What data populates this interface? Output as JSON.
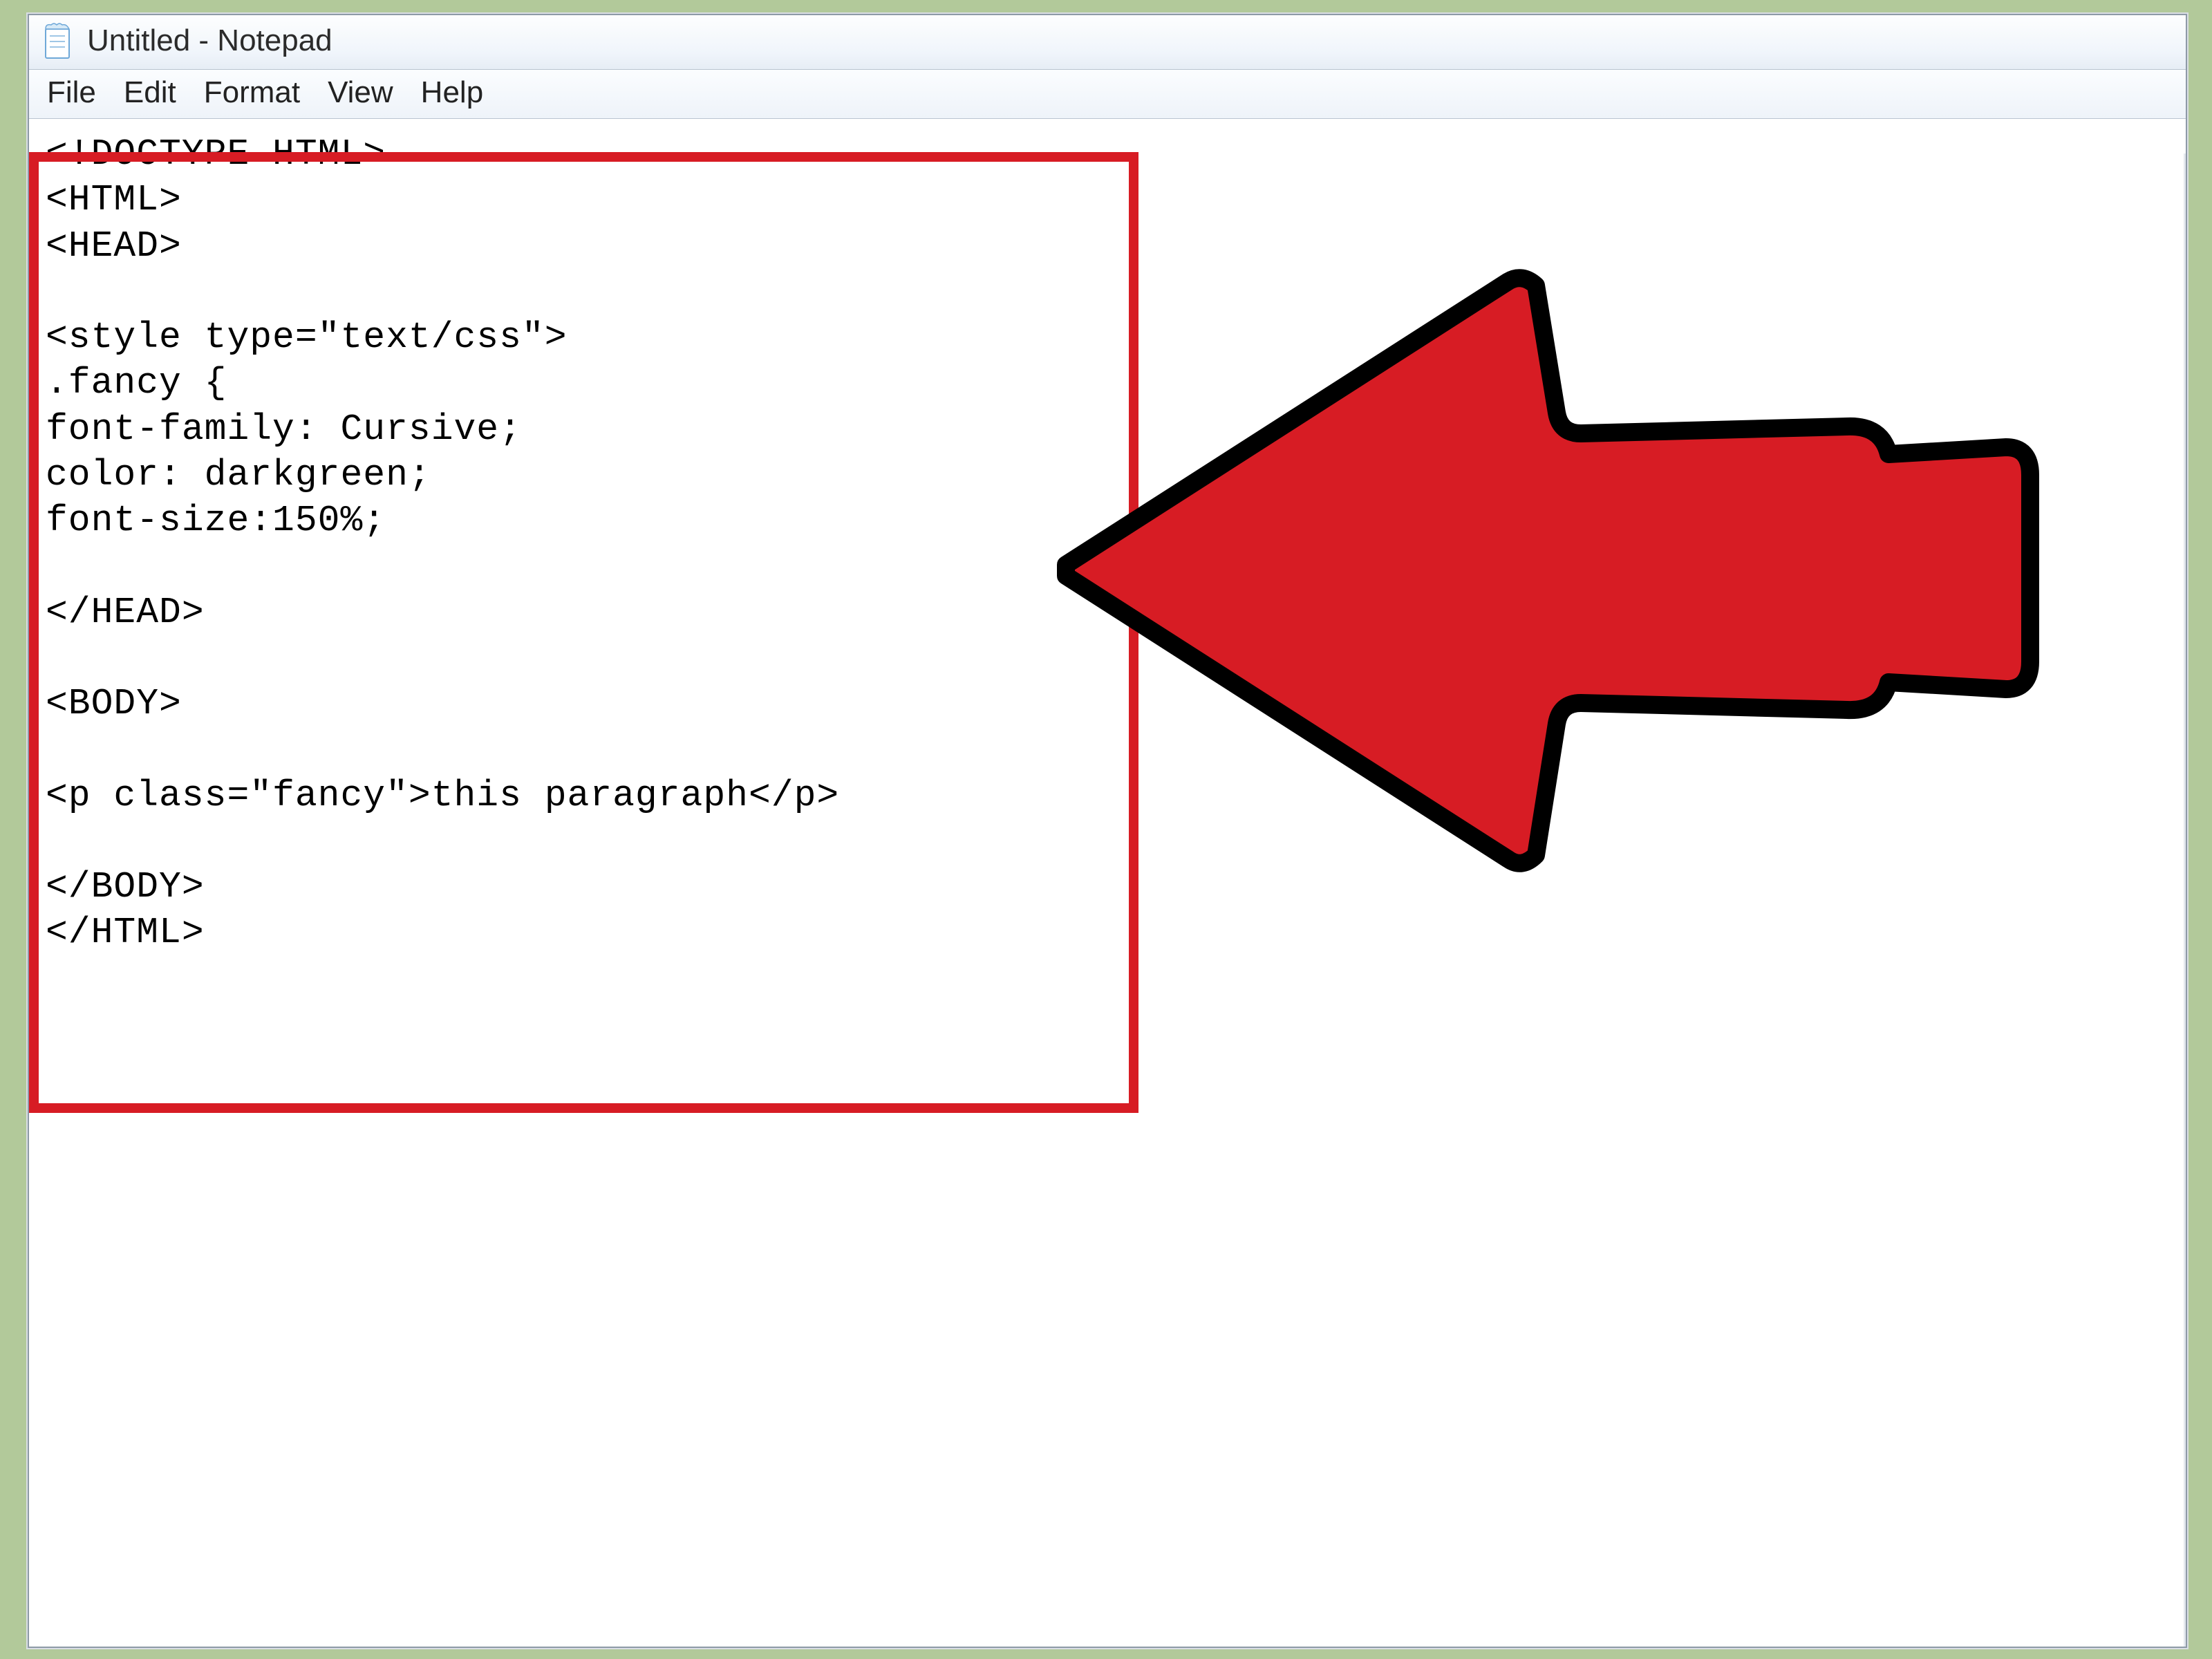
{
  "window": {
    "title": "Untitled - Notepad"
  },
  "menu": {
    "items": [
      "File",
      "Edit",
      "Format",
      "View",
      "Help"
    ]
  },
  "editor": {
    "content": "<!DOCTYPE HTML>\n<HTML>\n<HEAD>\n\n<style type=\"text/css\">\n.fancy {\nfont-family: Cursive;\ncolor: darkgreen;\nfont-size:150%;\n\n</HEAD>\n\n<BODY>\n\n<p class=\"fancy\">this paragraph</p>\n\n</BODY>\n</HTML>"
  },
  "annotation": {
    "highlight_color": "#d71c24",
    "arrow_color": "#d71c24"
  }
}
